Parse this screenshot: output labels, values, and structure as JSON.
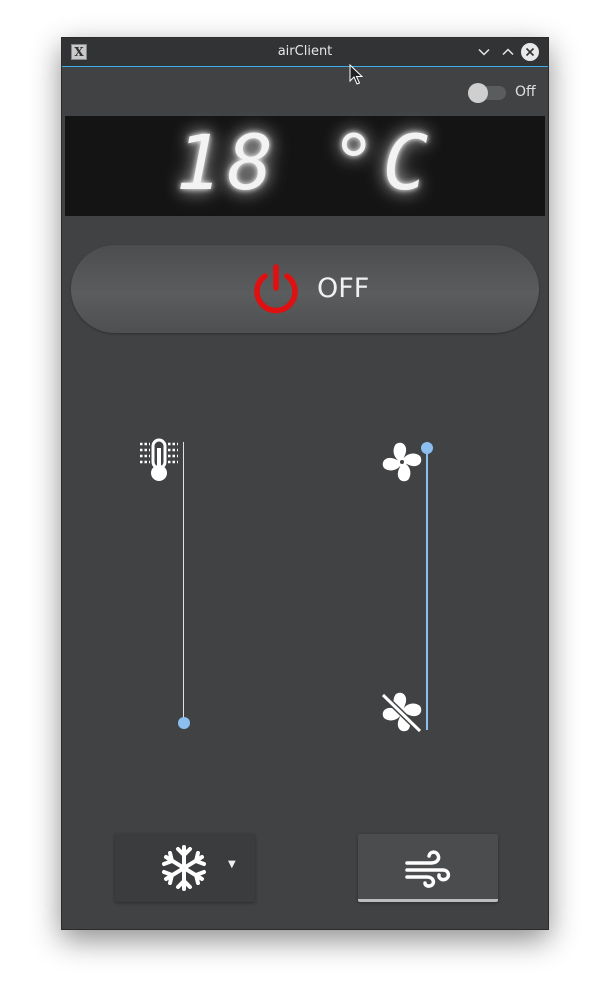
{
  "window": {
    "title": "airClient",
    "app_icon_glyph": "X",
    "controls": {
      "minimize_icon": "chevron-down-icon",
      "maximize_icon": "chevron-up-icon",
      "close_icon": "close-icon"
    }
  },
  "toggle": {
    "label": "Off",
    "state": false
  },
  "display": {
    "temperature_text": "18 °C"
  },
  "power": {
    "label": "OFF",
    "icon": "power-icon",
    "icon_color": "#e01010"
  },
  "sliders": {
    "temperature": {
      "icon": "thermometer-icon",
      "level": 0.0
    },
    "fan_speed": {
      "top_icon": "fan-icon",
      "bottom_icon": "fan-off-icon",
      "level": 1.0
    }
  },
  "mode": {
    "selected_icon": "snowflake-icon",
    "dropdown_icon": "dropdown-arrow-icon"
  },
  "wind_button": {
    "icon": "wind-icon",
    "checked": true
  },
  "colors": {
    "accent": "#8cbff0",
    "window_bg": "#404244",
    "display_bg": "#141414",
    "power_red": "#e01010",
    "title_underline": "#3daee9"
  }
}
